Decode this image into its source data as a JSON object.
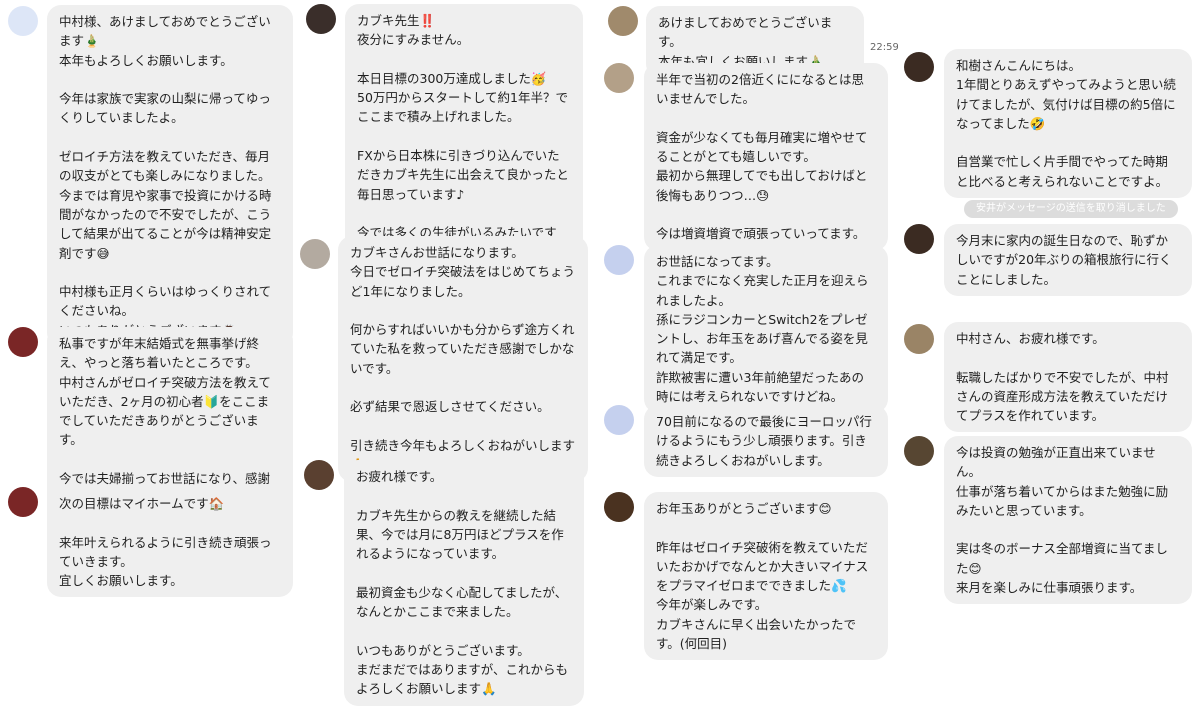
{
  "col1": {
    "m1": "中村様、あけましておめでとうございます🎍\n本年もよろしくお願いします。\n\n今年は家族で実家の山梨に帰ってゆっくりしていましたよ。\n\nゼロイチ方法を教えていただき、毎月の収支がとても楽しみになりました。\n今までは育児や家事で投資にかける時間がなかったので不安でしたが、こうして結果が出てることが今は精神安定剤です😅\n\n中村様も正月くらいはゆっくりされてくださいね。\nいつもありがとうございます🙇",
    "m2": "私事ですが年末結婚式を無事挙げ終え、やっと落ち着いたところです。\n中村さんがゼロイチ突破方法を教えていただき、2ヶ月の初心者🔰をここまでしていただきありがとうございます。\n\n今では夫婦揃ってお世話になり、感謝でしかありません。",
    "m3": "次の目標はマイホームです🏠\n\n来年叶えられるように引き続き頑張っていきます。\n宜しくお願いします。"
  },
  "col2": {
    "m1": "カブキ先生‼️\n夜分にすみません。\n\n本日目標の300万達成しました🥳\n50万円からスタートして約1年半？でここまで積み上げれました。\n\nFXから日本株に引きづり込んでいただきカブキ先生に出会えて良かったと毎日思っています♪\n\n今では多くの生徒がいるみたいですが、私も負けじと頑張っていきます🔥",
    "m2": "カブキさんお世話になります。\n今日でゼロイチ突破法をはじめてちょうど1年になりました。\n\n何からすればいいかも分からず途方くれていた私を救っていただき感謝でしかないです。\n\n必ず結果で恩返しさせてください。\n\n引き続き今年もよろしくおねがいします🙏",
    "m3": "お疲れ様です。\n\nカブキ先生からの教えを継続した結果、今では月に8万円ほどプラスを作れるようになっています。\n\n最初資金も少なく心配してましたが、なんとかここまで来ました。\n\nいつもありがとうございます。\nまだまだではありますが、これからもよろしくお願いします🙏"
  },
  "col3": {
    "m1": "あけましておめでとうございます。\n本年も宜しくお願いします🎍",
    "time1": "22:59",
    "m2": "半年で当初の2倍近くにになるとは思いませんでした。\n\n資金が少なくても毎月確実に増やせてることがとても嬉しいです。\n最初から無理してでも出しておけばと後悔もありつつ…😓\n\n今は増資増資で頑張っていってます。",
    "m3": "お世話になってます。\nこれまでになく充実した正月を迎えられましたよ。\n孫にラジコンカーとSwitch2をプレゼントし、お年玉をあげ喜んでる姿を見れて満足です。\n詐欺被害に遭い3年前絶望だったあの時には考えられないですけどね。",
    "m4": "70目前になるので最後にヨーロッパ行けるようにもう少し頑張ります。引き続きよろしくおねがいします。",
    "m5": "お年玉ありがとうございます😊\n\n昨年はゼロイチ突破術を教えていただいたおかげでなんとか大きいマイナスをプラマイゼロまでできました💦\n今年が楽しみです。\nカブキさんに早く出会いたかったです。(何回目)"
  },
  "col4": {
    "m1": "和樹さんこんにちは。\n1年間とりあえずやってみようと思い続けてましたが、気付けば目標の約5倍になってました🤣\n\n自営業で忙しく片手間でやってた時期と比べると考えられないことですよ。",
    "sys": "安井がメッセージの送信を取り消しました",
    "m2": "今月末に家内の誕生日なので、恥ずかしいですが20年ぶりの箱根旅行に行くことにしました。",
    "m3": "中村さん、お疲れ様です。\n\n転職したばかりで不安でしたが、中村さんの資産形成方法を教えていただけてプラスを作れています。",
    "m4": "今は投資の勉強が正直出来ていません。\n仕事が落ち着いてからはまた勉強に励みたいと思っています。\n\n実は冬のボーナス全部増資に当てました😊\n来月を楽しみに仕事頑張ります。"
  },
  "colors": {
    "bubble": "#efefef",
    "page": "#ffffff",
    "system_pill": "#dcdcdc"
  }
}
